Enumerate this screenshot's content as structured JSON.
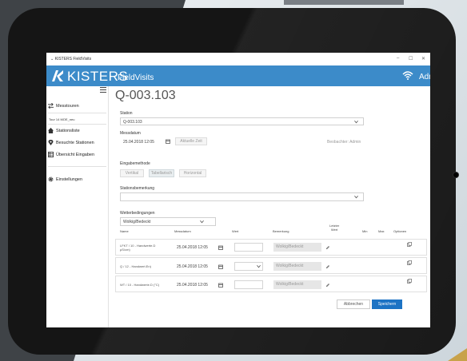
{
  "window": {
    "title": "KISTERS FieldVisits",
    "minimize": "–",
    "maximize": "☐",
    "close": "✕"
  },
  "banner": {
    "brand": "KISTERS",
    "product": "FieldVisits",
    "user": "Admin"
  },
  "sidebar": {
    "items": [
      {
        "label": "Messtouren"
      },
      {
        "label": "Stationsliste"
      },
      {
        "label": "Besuchte Stationen"
      },
      {
        "label": "Übersicht Eingaben"
      },
      {
        "label": "Einstellungen"
      }
    ],
    "tour": "Tour 14 MOE_neu"
  },
  "page": {
    "title_prefix": "Q-00",
    "title_rest": "3.103"
  },
  "station": {
    "label": "Station",
    "value": "Q-003.103"
  },
  "messdatum": {
    "label": "Messdatum",
    "value": "25.04.2018 12:05",
    "current_button": "Aktuelle Zeit"
  },
  "observer": {
    "label": "Beobachter: Admin"
  },
  "eingabe": {
    "label": "Eingabemethode",
    "options": [
      "Vertikal",
      "Tabellarisch",
      "Horizontal"
    ]
  },
  "stationsbemerkung": {
    "label": "Stationsbemerkung",
    "value": ""
  },
  "wetter": {
    "label": "Wetterbedingungen",
    "value": "Wolkig/Bedeckt"
  },
  "table": {
    "headers": {
      "name": "Name",
      "date": "Messdatum",
      "value": "Wert",
      "remark": "Bemerkung",
      "last1": "Letzter",
      "last2": "Wert",
      "min": "Min",
      "max": "Max",
      "options": "Optionen"
    },
    "rows": [
      {
        "name1": "LFKT / 10 - Handwerte.D",
        "name2": "µS/cm)",
        "date": "25.04.2018 12:05",
        "value": "",
        "remark": "Wolkig/Bedeckt"
      },
      {
        "name1": "Q / 12 - Handwert.En)",
        "name2": "",
        "date": "25.04.2018 12:05",
        "value": "",
        "remark": "Wolkig/Bedeckt"
      },
      {
        "name1": "WT / 10 - Handwerte.D (°C)",
        "name2": "",
        "date": "25.04.2018 12:05",
        "value": "",
        "remark": "Wolkig/Bedeckt"
      }
    ]
  },
  "actions": {
    "cancel": "Abbrechen",
    "save": "Speichern"
  },
  "colors": {
    "banner": "#3c8bc9",
    "save": "#1c73c4"
  }
}
